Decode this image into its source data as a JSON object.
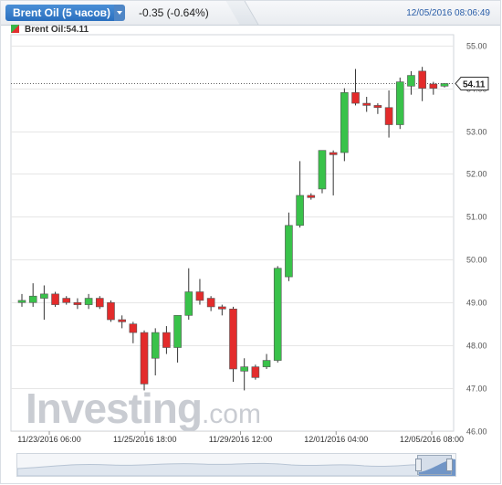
{
  "header": {
    "tab_label": "Brent Oil (5 часов)",
    "change": "-0.35 (-0.64%)",
    "timestamp": "12/05/2016 08:06:49"
  },
  "legend": {
    "label": "Brent Oil:54.11"
  },
  "watermark": {
    "brand": "Investing",
    "suffix": ".com"
  },
  "colors": {
    "up": "#39c24a",
    "down": "#e32b2b",
    "grid": "#e6e6e6",
    "price_tag": "#ffffff"
  },
  "chart_data": {
    "type": "candlestick",
    "title": "Brent Oil (5 часов)",
    "ylim": [
      46.0,
      55.25
    ],
    "y_ticks": [
      46.0,
      47.0,
      48.0,
      49.0,
      50.0,
      51.0,
      52.0,
      53.0,
      54.0,
      55.0
    ],
    "x_tick_labels": [
      "11/23/2016 06:00",
      "11/25/2016 18:00",
      "11/29/2016 12:00",
      "12/01/2016 04:00",
      "12/05/2016 08:00"
    ],
    "current_price": 54.11,
    "candles": [
      {
        "o": 49.0,
        "h": 49.2,
        "l": 48.9,
        "c": 49.05
      },
      {
        "o": 49.0,
        "h": 49.45,
        "l": 48.9,
        "c": 49.15
      },
      {
        "o": 49.1,
        "h": 49.4,
        "l": 48.6,
        "c": 49.2
      },
      {
        "o": 49.2,
        "h": 49.25,
        "l": 48.9,
        "c": 48.95
      },
      {
        "o": 49.1,
        "h": 49.15,
        "l": 48.95,
        "c": 49.0
      },
      {
        "o": 49.0,
        "h": 49.1,
        "l": 48.85,
        "c": 48.95
      },
      {
        "o": 48.95,
        "h": 49.2,
        "l": 48.85,
        "c": 49.1
      },
      {
        "o": 49.1,
        "h": 49.15,
        "l": 48.85,
        "c": 48.9
      },
      {
        "o": 49.0,
        "h": 49.05,
        "l": 48.55,
        "c": 48.6
      },
      {
        "o": 48.6,
        "h": 48.7,
        "l": 48.4,
        "c": 48.55
      },
      {
        "o": 48.5,
        "h": 48.55,
        "l": 48.05,
        "c": 48.3
      },
      {
        "o": 48.3,
        "h": 48.35,
        "l": 46.95,
        "c": 47.1
      },
      {
        "o": 47.7,
        "h": 48.4,
        "l": 47.3,
        "c": 48.3
      },
      {
        "o": 48.3,
        "h": 48.45,
        "l": 47.8,
        "c": 47.95
      },
      {
        "o": 47.95,
        "h": 48.7,
        "l": 47.6,
        "c": 48.7
      },
      {
        "o": 48.7,
        "h": 49.8,
        "l": 48.6,
        "c": 49.25
      },
      {
        "o": 49.25,
        "h": 49.55,
        "l": 48.95,
        "c": 49.05
      },
      {
        "o": 49.1,
        "h": 49.15,
        "l": 48.8,
        "c": 48.9
      },
      {
        "o": 48.9,
        "h": 48.95,
        "l": 48.7,
        "c": 48.85
      },
      {
        "o": 48.85,
        "h": 48.9,
        "l": 47.15,
        "c": 47.45
      },
      {
        "o": 47.4,
        "h": 47.7,
        "l": 46.95,
        "c": 47.5
      },
      {
        "o": 47.5,
        "h": 47.55,
        "l": 47.2,
        "c": 47.25
      },
      {
        "o": 47.5,
        "h": 47.8,
        "l": 47.45,
        "c": 47.65
      },
      {
        "o": 47.65,
        "h": 49.85,
        "l": 47.6,
        "c": 49.8
      },
      {
        "o": 49.6,
        "h": 51.1,
        "l": 49.5,
        "c": 50.8
      },
      {
        "o": 50.8,
        "h": 52.3,
        "l": 50.75,
        "c": 51.5
      },
      {
        "o": 51.5,
        "h": 51.55,
        "l": 51.4,
        "c": 51.45
      },
      {
        "o": 51.65,
        "h": 52.55,
        "l": 51.55,
        "c": 52.55
      },
      {
        "o": 52.5,
        "h": 52.55,
        "l": 51.5,
        "c": 52.45
      },
      {
        "o": 52.5,
        "h": 54.0,
        "l": 52.3,
        "c": 53.9
      },
      {
        "o": 53.9,
        "h": 54.45,
        "l": 53.6,
        "c": 53.65
      },
      {
        "o": 53.65,
        "h": 53.8,
        "l": 53.45,
        "c": 53.6
      },
      {
        "o": 53.6,
        "h": 53.65,
        "l": 53.4,
        "c": 53.55
      },
      {
        "o": 53.55,
        "h": 53.95,
        "l": 52.85,
        "c": 53.15
      },
      {
        "o": 53.15,
        "h": 54.25,
        "l": 53.05,
        "c": 54.15
      },
      {
        "o": 54.05,
        "h": 54.4,
        "l": 53.85,
        "c": 54.3
      },
      {
        "o": 54.4,
        "h": 54.5,
        "l": 53.7,
        "c": 54.0
      },
      {
        "o": 54.1,
        "h": 54.15,
        "l": 53.85,
        "c": 54.0
      },
      {
        "o": 54.05,
        "h": 54.12,
        "l": 54.02,
        "c": 54.11
      }
    ]
  }
}
